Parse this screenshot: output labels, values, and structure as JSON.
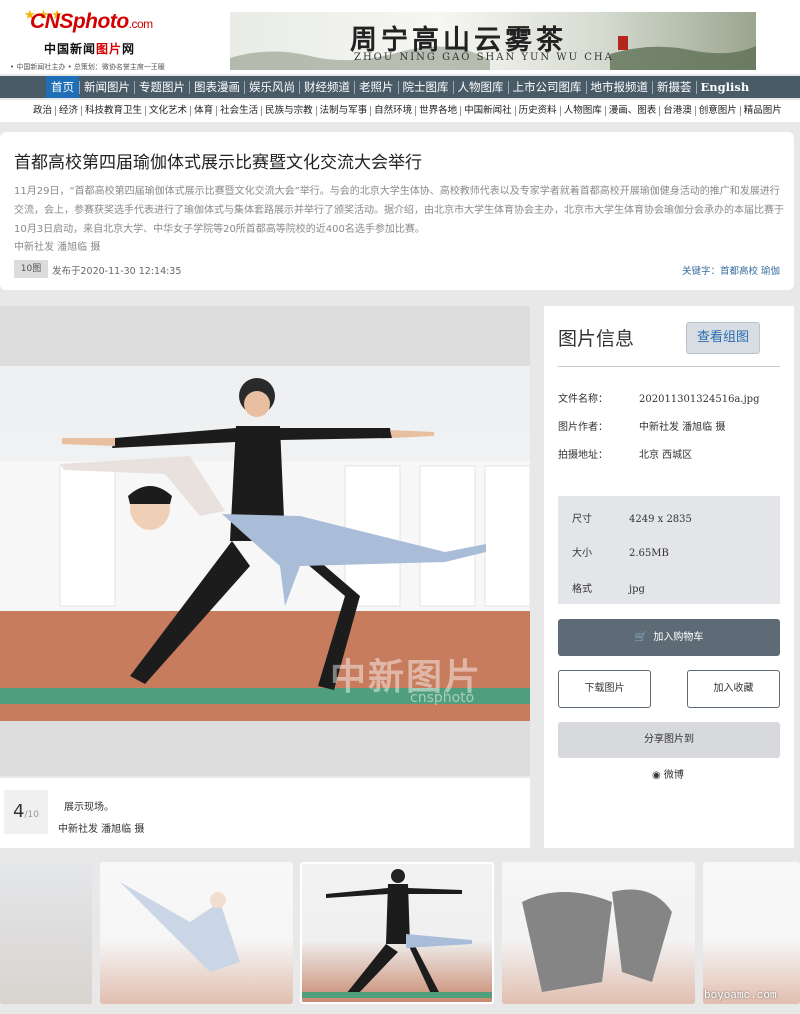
{
  "header": {
    "brand": "CNSphoto",
    "brand_suffix": ".com",
    "cn_name_1": "中国新闻",
    "cn_name_2": "图片",
    "cn_name_3": "网",
    "slogan": "• 中国新闻社主办 • 总策划：微协名誉主席一王暖",
    "banner_title": "周宁高山云雾茶",
    "banner_pinyin": "ZHOU NING GAO SHAN YUN WU CHA"
  },
  "nav": {
    "items": [
      "首页",
      "新闻图片",
      "专题图片",
      "图表漫画",
      "娱乐风尚",
      "财经频道",
      "老照片",
      "院士图库",
      "人物图库",
      "上市公司图库",
      "地市报频道",
      "新摄荟",
      "English"
    ]
  },
  "subnav": {
    "items": [
      "政治",
      "经济",
      "科技教育卫生",
      "文化艺术",
      "体育",
      "社会生活",
      "民族与宗教",
      "法制与军事",
      "自然环境",
      "世界各地",
      "中国新闻社",
      "历史资料",
      "人物图库",
      "漫画、图表",
      "台港澳",
      "创意图片",
      "精品图片"
    ]
  },
  "article": {
    "title": "首都高校第四届瑜伽体式展示比赛暨文化交流大会举行",
    "summary": "11月29日，“首都高校第四届瑜伽体式展示比赛暨文化交流大会”举行。与会的北京大学生体协、高校教师代表以及专家学者就着首都高校开展瑜伽健身活动的推广和发展进行交流，会上，参赛获奖选手代表进行了瑜伽体式与集体套路展示并举行了颁奖活动。据介绍，由北京市大学生体育协会主办，北京市大学生体育协会瑜伽分会承办的本届比赛于10月3日启动，来自北京大学、中华女子学院等20所首都高等院校的近400名选手参加比赛。",
    "credit": "中新社发 潘旭临 摄",
    "image_count": "10图",
    "published": "发布于2020-11-30 12:14:35",
    "keywords": "关键字：首都高校 瑜伽"
  },
  "viewer": {
    "watermark": "中新图片",
    "watermark_en": "cnsphoto",
    "index": "4",
    "total": "/10",
    "caption": "展示现场。",
    "caption_credit": "中新社发 潘旭临 摄"
  },
  "info": {
    "heading": "图片信息",
    "view_group": "查看组图",
    "filename_label": "文件名称：",
    "filename": "202011301324516a.jpg",
    "author_label": "图片作者：",
    "author": "中新社发 潘旭临 摄",
    "location_label": "拍摄地址：",
    "location": "北京 西城区",
    "size_label": "尺寸",
    "size": "4249 x 2835",
    "filesize_label": "大小",
    "filesize": "2.65MB",
    "format_label": "格式",
    "format": "jpg",
    "add_cart": "加入购物车",
    "download": "下载图片",
    "favorite": "加入收藏",
    "share": "分享图片到",
    "weibo": "微博"
  },
  "site_watermark": "boyoamc.com"
}
